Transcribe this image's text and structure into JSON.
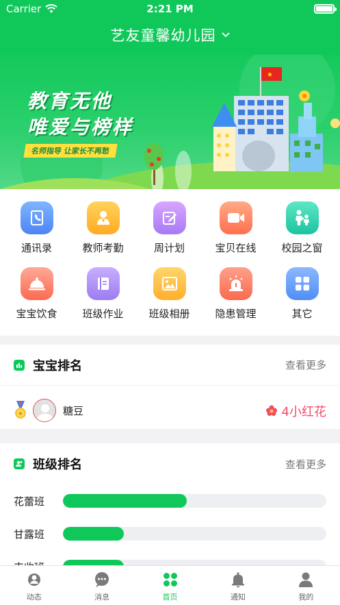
{
  "status_bar": {
    "carrier": "Carrier",
    "time": "2:21 PM"
  },
  "header": {
    "school_name": "艺友童馨幼儿园"
  },
  "banner": {
    "slogan_line1": "教育无他",
    "slogan_line2": "唯爱与榜样",
    "tagline": "名师指导 让家长不再愁"
  },
  "grid": {
    "items": [
      {
        "label": "通讯录",
        "icon": "contacts-icon",
        "color_top": "#7fb6ff",
        "color_bottom": "#4d84f5"
      },
      {
        "label": "教师考勤",
        "icon": "teacher-icon",
        "color_top": "#ffd35c",
        "color_bottom": "#ffab24"
      },
      {
        "label": "周计划",
        "icon": "edit-icon",
        "color_top": "#d9a6ff",
        "color_bottom": "#a67af5"
      },
      {
        "label": "宝贝在线",
        "icon": "video-icon",
        "color_top": "#ffaa88",
        "color_bottom": "#ff6f4e"
      },
      {
        "label": "校园之窗",
        "icon": "parent-child-icon",
        "color_top": "#5ee7c4",
        "color_bottom": "#1cc3a0"
      },
      {
        "label": "宝宝饮食",
        "icon": "food-bell-icon",
        "color_top": "#ffa996",
        "color_bottom": "#fb6a52"
      },
      {
        "label": "班级作业",
        "icon": "book-icon",
        "color_top": "#c8aeff",
        "color_bottom": "#9c7cf0"
      },
      {
        "label": "班级相册",
        "icon": "photo-icon",
        "color_top": "#ffd66a",
        "color_bottom": "#ffaf2d"
      },
      {
        "label": "隐患管理",
        "icon": "alarm-icon",
        "color_top": "#ffa08b",
        "color_bottom": "#fa6a4e"
      },
      {
        "label": "其它",
        "icon": "apps-icon",
        "color_top": "#8cb8ff",
        "color_bottom": "#4f8ef7"
      }
    ]
  },
  "baby_rank": {
    "title": "宝宝排名",
    "more": "查看更多",
    "entries": [
      {
        "name": "糖豆",
        "score": "4小红花"
      }
    ]
  },
  "class_rank": {
    "title": "班级排名",
    "more": "查看更多",
    "entries": [
      {
        "name": "花蕾班",
        "fraction": 0.47
      },
      {
        "name": "甘露班",
        "fraction": 0.23
      },
      {
        "name": "丰收班",
        "fraction": 0.23
      }
    ]
  },
  "tabbar": {
    "tabs": [
      {
        "label": "动态",
        "icon": "moments-icon",
        "active": false
      },
      {
        "label": "消息",
        "icon": "message-icon",
        "active": false
      },
      {
        "label": "首页",
        "icon": "home-clover-icon",
        "active": true
      },
      {
        "label": "通知",
        "icon": "bell-icon",
        "active": false
      },
      {
        "label": "我的",
        "icon": "profile-icon",
        "active": false
      }
    ]
  },
  "colors": {
    "brand": "#10c85a",
    "flower_text": "#f24b6a"
  }
}
